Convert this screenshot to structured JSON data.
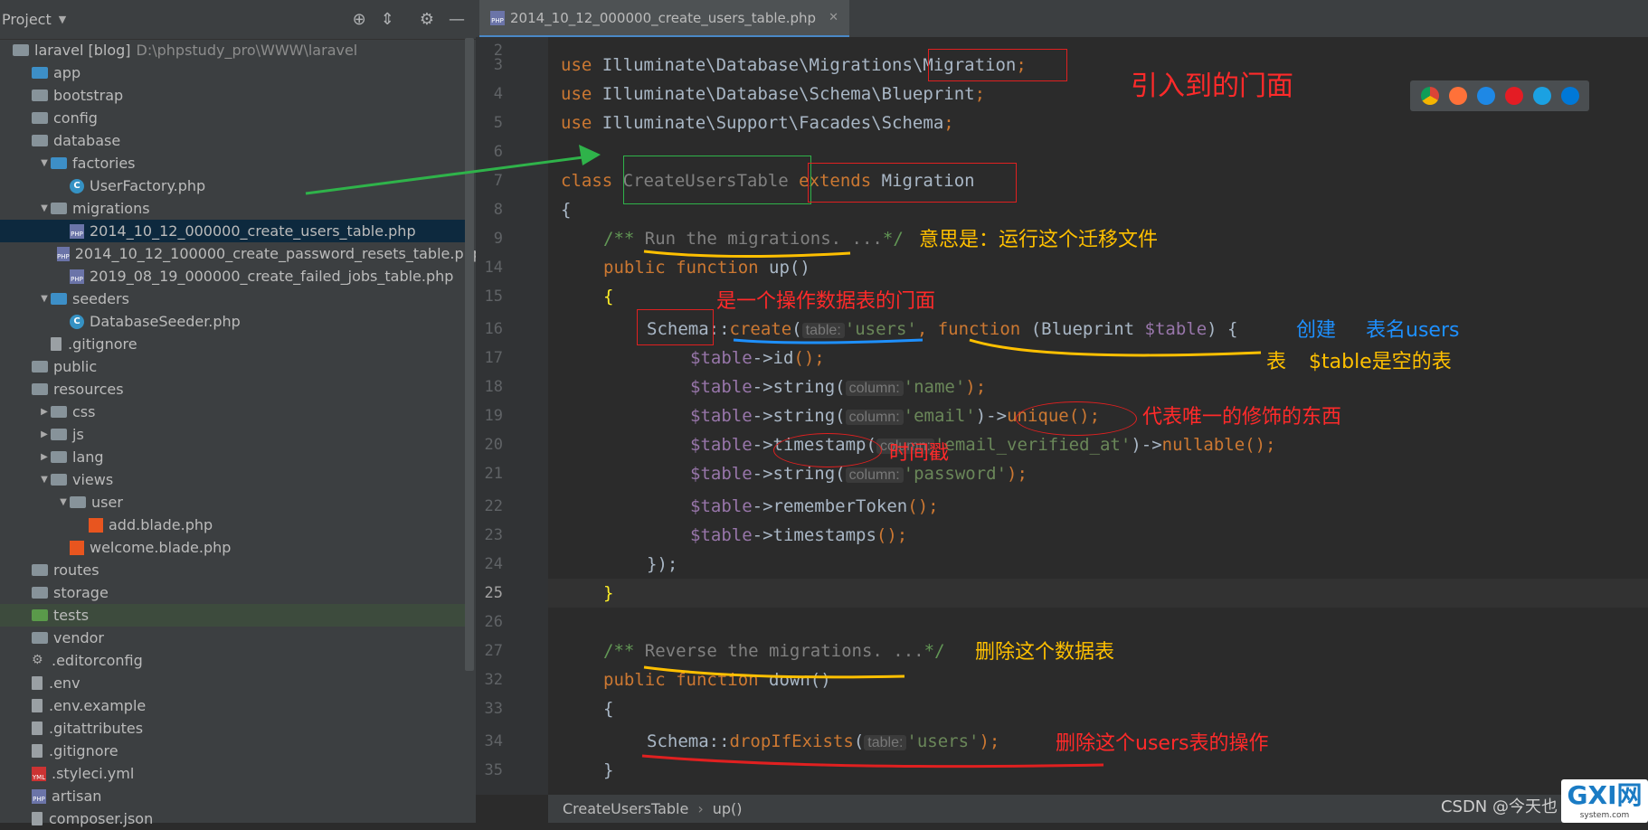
{
  "sidebar": {
    "title": "Project",
    "rows": [
      {
        "label": "laravel [blog]",
        "extra": "D:\\phpstudy_pro\\WWW\\laravel",
        "indent": 0,
        "arrow": "",
        "icon": "folder"
      },
      {
        "label": "app",
        "indent": 1,
        "arrow": "",
        "icon": "folder-blue"
      },
      {
        "label": "bootstrap",
        "indent": 1,
        "arrow": "",
        "icon": "folder"
      },
      {
        "label": "config",
        "indent": 1,
        "arrow": "",
        "icon": "folder"
      },
      {
        "label": "database",
        "indent": 1,
        "arrow": "",
        "icon": "folder"
      },
      {
        "label": "factories",
        "indent": 2,
        "arrow": "▼",
        "icon": "folder-blue"
      },
      {
        "label": "UserFactory.php",
        "indent": 3,
        "arrow": "",
        "icon": "class"
      },
      {
        "label": "migrations",
        "indent": 2,
        "arrow": "▼",
        "icon": "folder"
      },
      {
        "label": "2014_10_12_000000_create_users_table.php",
        "indent": 3,
        "arrow": "",
        "icon": "php",
        "selected": true
      },
      {
        "label": "2014_10_12_100000_create_password_resets_table.php",
        "indent": 3,
        "arrow": "",
        "icon": "php"
      },
      {
        "label": "2019_08_19_000000_create_failed_jobs_table.php",
        "indent": 3,
        "arrow": "",
        "icon": "php"
      },
      {
        "label": "seeders",
        "indent": 2,
        "arrow": "▼",
        "icon": "folder-blue"
      },
      {
        "label": "DatabaseSeeder.php",
        "indent": 3,
        "arrow": "",
        "icon": "class"
      },
      {
        "label": ".gitignore",
        "indent": 2,
        "arrow": "",
        "icon": "file"
      },
      {
        "label": "public",
        "indent": 1,
        "arrow": "",
        "icon": "folder"
      },
      {
        "label": "resources",
        "indent": 1,
        "arrow": "",
        "icon": "folder"
      },
      {
        "label": "css",
        "indent": 2,
        "arrow": "▶",
        "icon": "folder"
      },
      {
        "label": "js",
        "indent": 2,
        "arrow": "▶",
        "icon": "folder"
      },
      {
        "label": "lang",
        "indent": 2,
        "arrow": "▶",
        "icon": "folder"
      },
      {
        "label": "views",
        "indent": 2,
        "arrow": "▼",
        "icon": "folder"
      },
      {
        "label": "user",
        "indent": 3,
        "arrow": "▼",
        "icon": "folder"
      },
      {
        "label": "add.blade.php",
        "indent": 4,
        "arrow": "",
        "icon": "blade"
      },
      {
        "label": "welcome.blade.php",
        "indent": 3,
        "arrow": "",
        "icon": "blade"
      },
      {
        "label": "routes",
        "indent": 1,
        "arrow": "",
        "icon": "folder"
      },
      {
        "label": "storage",
        "indent": 1,
        "arrow": "",
        "icon": "folder"
      },
      {
        "label": "tests",
        "indent": 1,
        "arrow": "",
        "icon": "folder-green",
        "highlight": true
      },
      {
        "label": "vendor",
        "indent": 1,
        "arrow": "",
        "icon": "folder"
      },
      {
        "label": ".editorconfig",
        "indent": 1,
        "arrow": "",
        "icon": "gear"
      },
      {
        "label": ".env",
        "indent": 1,
        "arrow": "",
        "icon": "file"
      },
      {
        "label": ".env.example",
        "indent": 1,
        "arrow": "",
        "icon": "file"
      },
      {
        "label": ".gitattributes",
        "indent": 1,
        "arrow": "",
        "icon": "file"
      },
      {
        "label": ".gitignore",
        "indent": 1,
        "arrow": "",
        "icon": "file"
      },
      {
        "label": ".styleci.yml",
        "indent": 1,
        "arrow": "",
        "icon": "yml"
      },
      {
        "label": "artisan",
        "indent": 1,
        "arrow": "",
        "icon": "php"
      },
      {
        "label": "composer.json",
        "indent": 1,
        "arrow": "",
        "icon": "file"
      }
    ]
  },
  "editor": {
    "tab_label": "2014_10_12_000000_create_users_table.php",
    "line_numbers": [
      "2",
      "3",
      "4",
      "5",
      "6",
      "7",
      "8",
      "9",
      "14",
      "15",
      "16",
      "17",
      "18",
      "19",
      "20",
      "21",
      "22",
      "23",
      "24",
      "25",
      "26",
      "27",
      "32",
      "33",
      "34",
      "35"
    ],
    "current_line": "25"
  },
  "code": {
    "use1_a": "use ",
    "use1_b": "Illuminate\\Database\\Migrations",
    "use1_c": "\\Migration",
    "use1_d": ";",
    "use2_a": "use ",
    "use2_b": "Illuminate\\Database\\Schema\\Blueprint",
    "use2_c": ";",
    "use3_a": "use ",
    "use3_b": "Illuminate\\Support\\Facades\\Schema",
    "use3_c": ";",
    "class_kw": "class ",
    "class_name": "CreateUsersTable",
    "extends_kw": " extends ",
    "extends_name": "Migration",
    "brace_open": "{",
    "doc1_a": "/** ",
    "doc1_b": "Run the migrations. ...",
    "doc1_c": "*/",
    "up_pub": "public ",
    "up_fn": "function ",
    "up_name": "up",
    "up_paren": "()",
    "up_brace": "{",
    "s16_schema": "Schema",
    "s16_sep": "::",
    "s16_create": "create",
    "s16_p": "(",
    "s16_hint": "table:",
    "s16_str": "'users'",
    "s16_comma": ", ",
    "s16_fn": "function ",
    "s16_rest": "(Blueprint ",
    "s16_var": "$table",
    "s16_end": ") {",
    "l17_var": "$table",
    "l17_arrow": "->",
    "l17_call": "id",
    "l17_end": "();",
    "l18_var": "$table",
    "l18_arrow": "->",
    "l18_call": "string",
    "l18_p": "(",
    "l18_hint": "column:",
    "l18_str": "'name'",
    "l18_end": ");",
    "l19_var": "$table",
    "l19_arrow": "->",
    "l19_call": "string",
    "l19_p": "(",
    "l19_hint": "column:",
    "l19_str": "'email'",
    "l19_mid": ")->",
    "l19_call2": "unique",
    "l19_end": "();",
    "l20_var": "$table",
    "l20_arrow": "->",
    "l20_call": "timestamp",
    "l20_p": "(",
    "l20_hint": "column:",
    "l20_str": "'email_verified_at'",
    "l20_mid": ")->",
    "l20_call2": "nullable",
    "l20_end": "();",
    "l21_var": "$table",
    "l21_arrow": "->",
    "l21_call": "string",
    "l21_p": "(",
    "l21_hint": "column:",
    "l21_str": "'password'",
    "l21_end": ");",
    "l22_var": "$table",
    "l22_arrow": "->",
    "l22_call": "rememberToken",
    "l22_end": "();",
    "l23_var": "$table",
    "l23_arrow": "->",
    "l23_call": "timestamps",
    "l23_end": "();",
    "l24": "});",
    "l25": "}",
    "doc2_a": "/** ",
    "doc2_b": "Reverse the migrations. ...",
    "doc2_c": "*/",
    "down_pub": "public ",
    "down_fn": "function ",
    "down_name": "down",
    "down_paren": "()",
    "down_brace": "{",
    "s34_schema": "Schema",
    "s34_sep": "::",
    "s34_call": "dropIfExists",
    "s34_p": "(",
    "s34_hint": "table:",
    "s34_str": "'users'",
    "s34_end": ");",
    "down_close": "}"
  },
  "annotations": {
    "facade": "引入到的门面",
    "run": "意思是：运行这个迁移文件",
    "schema_facade": "是一个操作数据表的门面",
    "create": "创建",
    "table_name": "表名users",
    "biao": "表",
    "table_empty": "$table是空的表",
    "unique": "代表唯一的修饰的东西",
    "timestamp": "时间戳",
    "delete_table": "删除这个数据表",
    "delete_users": "删除这个users表的操作"
  },
  "statusbar": {
    "crumb1": "CreateUsersTable",
    "crumb2": "up()",
    "watermark": "CSDN @今天也",
    "logo": "GXI网",
    "logo_sub": "system.com"
  },
  "colors": {
    "annotation_red": "#ff2a2a",
    "annotation_yellow": "#ffc000",
    "annotation_blue": "#1e90ff",
    "arrow_green": "#2fb34a"
  }
}
